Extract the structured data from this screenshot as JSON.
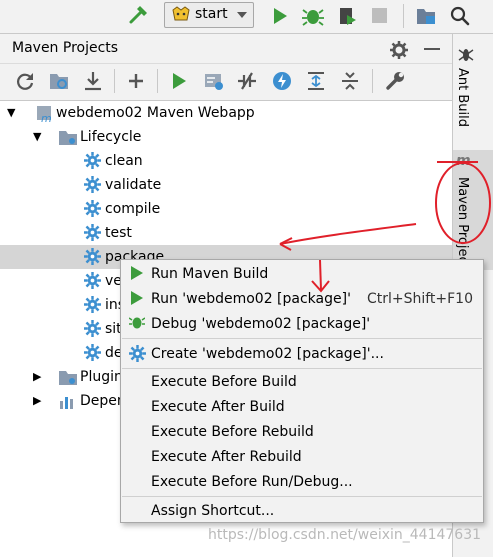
{
  "toolbar_top": {
    "run_config_label": "start"
  },
  "panel": {
    "title": "Maven Projects"
  },
  "side_tabs": {
    "ant_build": "Ant Build",
    "maven_projects": "Maven Projec"
  },
  "tree": {
    "project": "webdemo02 Maven Webapp",
    "lifecycle": "Lifecycle",
    "goals": [
      "clean",
      "validate",
      "compile",
      "test",
      "package",
      "ve",
      "ins",
      "sit",
      "de"
    ],
    "plugins": "Plugin",
    "dependencies": "Depen"
  },
  "context_menu": {
    "run_maven_build": "Run Maven Build",
    "run_config": "Run 'webdemo02 [package]'",
    "run_config_shortcut": "Ctrl+Shift+F10",
    "debug_config": "Debug 'webdemo02 [package]'",
    "create_config": "Create 'webdemo02 [package]'...",
    "execute_before_build": "Execute Before Build",
    "execute_after_build": "Execute After Build",
    "execute_before_rebuild": "Execute Before Rebuild",
    "execute_after_rebuild": "Execute After Rebuild",
    "execute_before_run_debug": "Execute Before Run/Debug...",
    "assign_shortcut": "Assign Shortcut..."
  },
  "watermark": "https://blog.csdn.net/weixin_44147631",
  "colors": {
    "accent_green": "#3c9c3c",
    "annotation_red": "#e0202a",
    "selection": "#d5d5d5",
    "gear_blue": "#3c8fd0"
  }
}
